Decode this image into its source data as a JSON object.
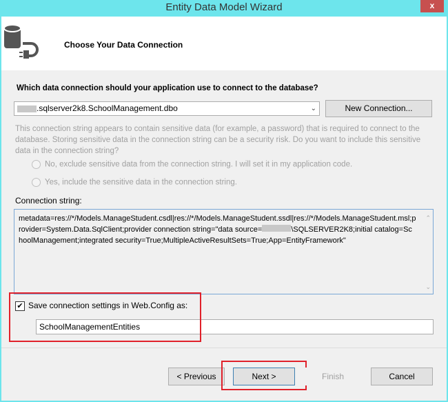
{
  "window": {
    "title": "Entity Data Model Wizard",
    "close_label": "x"
  },
  "header": {
    "title": "Choose Your Data Connection"
  },
  "question": "Which data connection should your application use to connect to the database?",
  "connection_combo": {
    "value": ".sqlserver2k8.SchoolManagement.dbo"
  },
  "new_connection_label": "New Connection...",
  "warning": "This connection string appears to contain sensitive data (for example, a password) that is required to connect to the database. Storing sensitive data in the connection string can be a security risk. Do you want to include this sensitive data in the connection string?",
  "radio_no": "No, exclude sensitive data from the connection string. I will set it in my application code.",
  "radio_yes": "Yes, include the sensitive data in the connection string.",
  "connection_string_label": "Connection string:",
  "connection_string": {
    "part1": "metadata=res://*/Models.ManageStudent.csdl|res://*/Models.ManageStudent.ssdl|res://*/Models.ManageStudent.msl;provider=System.Data.SqlClient;provider connection string=\"data source=",
    "part2": "\\SQLSERVER2K8;initial catalog=SchoolManagement;integrated security=True;MultipleActiveResultSets=True;App=EntityFramework\""
  },
  "save_settings": {
    "label": "Save connection settings in Web.Config as:",
    "checked": true,
    "value": "SchoolManagementEntities"
  },
  "footer": {
    "previous": "< Previous",
    "next": "Next >",
    "finish": "Finish",
    "cancel": "Cancel"
  }
}
